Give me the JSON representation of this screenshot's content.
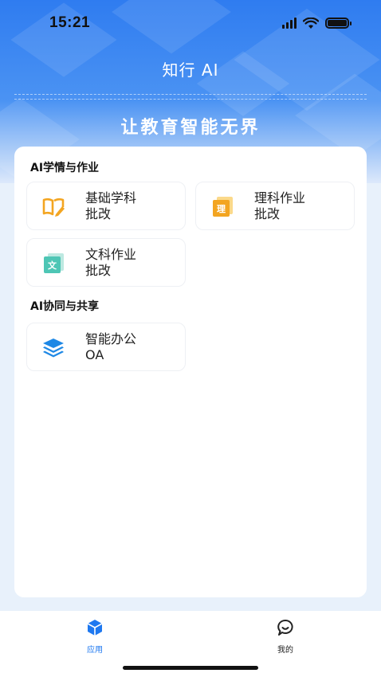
{
  "status_bar": {
    "time": "15:21"
  },
  "header": {
    "app_title": "知行 AI",
    "slogan": "让教育智能无界"
  },
  "sections": [
    {
      "title": "AI学情与作业",
      "cards": [
        {
          "label": "基础学科\n批改",
          "icon": "open-book-pen-icon"
        },
        {
          "label": "理科作业\n批改",
          "icon": "science-doc-icon"
        },
        {
          "label": "文科作业\n批改",
          "icon": "liberal-doc-icon"
        }
      ]
    },
    {
      "title": "AI协同与共享",
      "cards": [
        {
          "label": "智能办公\nOA",
          "icon": "layers-icon"
        }
      ]
    }
  ],
  "tabbar": {
    "items": [
      {
        "label": "应用",
        "icon": "cube-icon",
        "active": true
      },
      {
        "label": "我的",
        "icon": "chat-profile-icon",
        "active": false
      }
    ]
  },
  "colors": {
    "accent": "#2f7cf0",
    "active_tab": "#1e78f0",
    "inactive_tab": "#222222",
    "orange_icon": "#f3a521",
    "teal_icon": "#4ec6b5",
    "blue_icon": "#1e88e5"
  },
  "icon_text": {
    "science": "理",
    "liberal": "文"
  }
}
